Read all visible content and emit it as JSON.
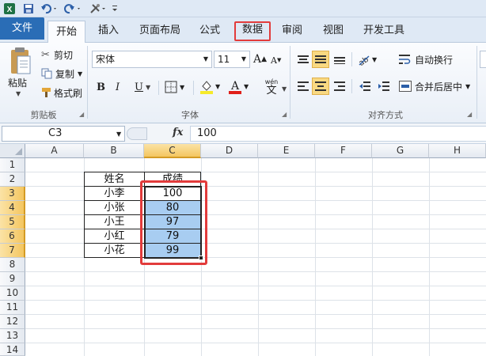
{
  "qat": {
    "icons": [
      "excel-icon",
      "save-icon",
      "undo-icon",
      "redo-icon",
      "customize-icon"
    ]
  },
  "tabs": [
    {
      "label": "文件"
    },
    {
      "label": "开始"
    },
    {
      "label": "插入"
    },
    {
      "label": "页面布局"
    },
    {
      "label": "公式"
    },
    {
      "label": "数据"
    },
    {
      "label": "审阅"
    },
    {
      "label": "视图"
    },
    {
      "label": "开发工具"
    }
  ],
  "clipboard": {
    "paste": "粘贴",
    "cut": "剪切",
    "copy": "复制",
    "format_painter": "格式刷",
    "group": "剪贴板"
  },
  "font": {
    "name": "宋体",
    "size": "11",
    "bold": "B",
    "italic": "I",
    "underline": "U",
    "wen": "wén",
    "wen_char": "文",
    "group": "字体"
  },
  "alignment": {
    "wrap": "自动换行",
    "merge": "合并后居中",
    "group": "对齐方式"
  },
  "formula_bar": {
    "name_box": "C3",
    "fx": "fx",
    "value": "100"
  },
  "columns": [
    "A",
    "B",
    "C",
    "D",
    "E",
    "F",
    "G",
    "H"
  ],
  "rows": [
    "1",
    "2",
    "3",
    "4",
    "5",
    "6",
    "7",
    "8",
    "9",
    "10",
    "11",
    "12",
    "13",
    "14"
  ],
  "table": {
    "header": [
      "姓名",
      "成绩"
    ],
    "rows": [
      [
        "小李",
        "100"
      ],
      [
        "小张",
        "80"
      ],
      [
        "小王",
        "97"
      ],
      [
        "小红",
        "79"
      ],
      [
        "小花",
        "99"
      ]
    ]
  },
  "colors": {
    "accent": "#2a6db6",
    "selection": "#a8cdf1",
    "highlight_border": "#e23b3b",
    "active_header": "#f4c660"
  }
}
